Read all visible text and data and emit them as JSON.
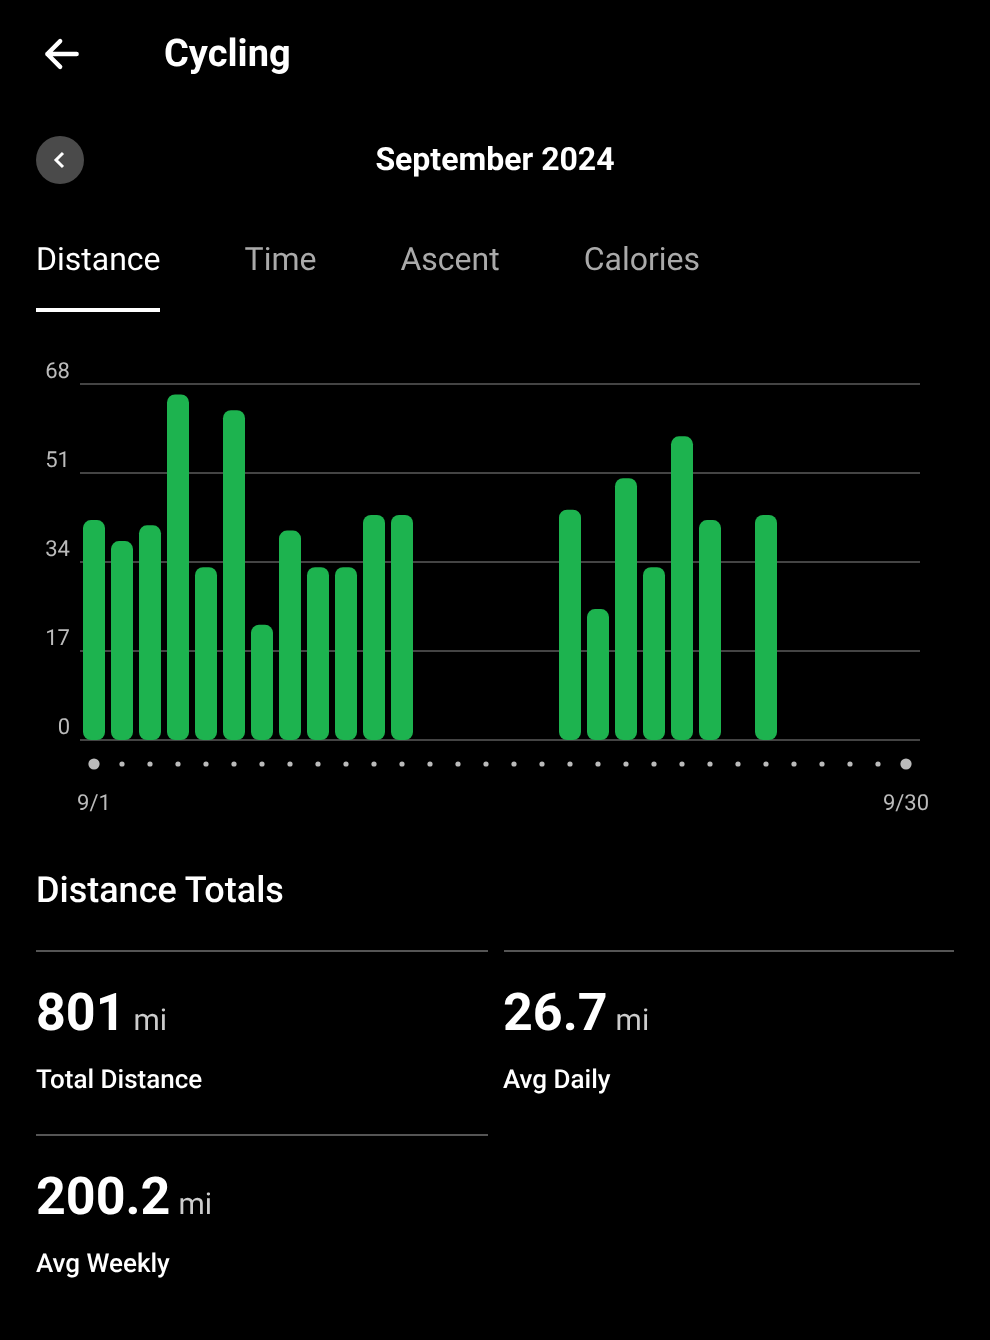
{
  "header": {
    "title": "Cycling"
  },
  "month_nav": {
    "label": "September 2024"
  },
  "tabs": [
    {
      "label": "Distance",
      "selected": true
    },
    {
      "label": "Time",
      "selected": false
    },
    {
      "label": "Ascent",
      "selected": false
    },
    {
      "label": "Calories",
      "selected": false
    }
  ],
  "chart_data": {
    "type": "bar",
    "categories": [
      "9/1",
      null,
      null,
      null,
      null,
      null,
      null,
      null,
      null,
      null,
      null,
      null,
      null,
      null,
      null,
      null,
      null,
      null,
      null,
      null,
      null,
      null,
      null,
      null,
      null,
      null,
      null,
      null,
      null,
      "9/30"
    ],
    "series": [
      {
        "color": "#1db34f",
        "values": [
          42,
          38,
          41,
          66,
          33,
          63,
          22,
          40,
          33,
          33,
          43,
          43,
          0,
          0,
          0,
          0,
          0,
          44,
          25,
          50,
          33,
          58,
          42,
          0,
          43,
          0,
          0,
          0,
          0,
          0
        ]
      }
    ],
    "grid": true,
    "ylim": [
      0,
      68
    ],
    "yticks": [
      0,
      17,
      34,
      51,
      68
    ]
  },
  "totals": {
    "title": "Distance Totals",
    "stats": [
      {
        "value": "801",
        "unit": "mi",
        "label": "Total Distance"
      },
      {
        "value": "26.7",
        "unit": "mi",
        "label": "Avg Daily"
      },
      {
        "value": "200.2",
        "unit": "mi",
        "label": "Avg Weekly"
      }
    ]
  }
}
